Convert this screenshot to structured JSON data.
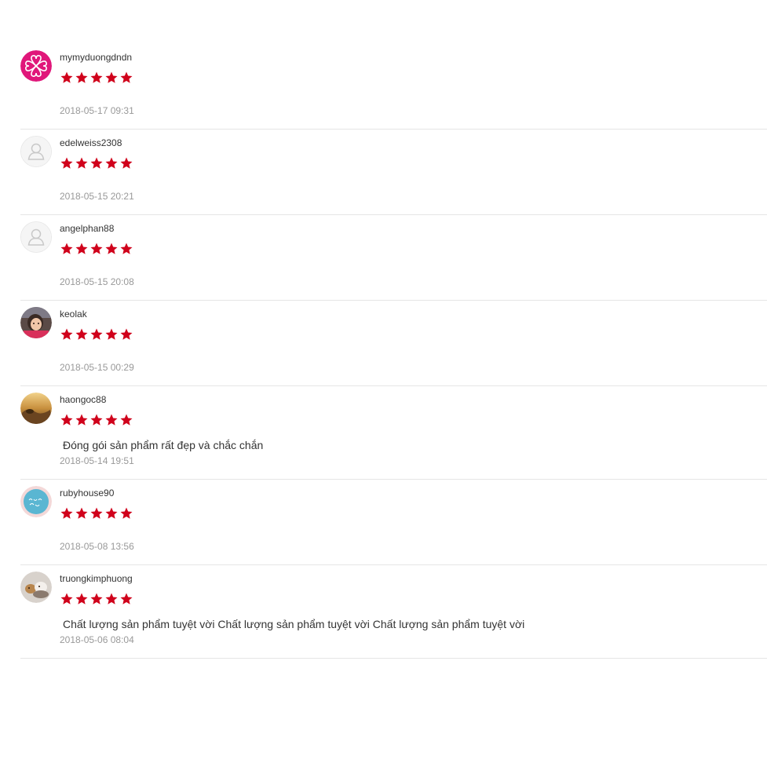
{
  "colors": {
    "star": "#d0011b",
    "divider": "#e5e5e5",
    "time": "#999999",
    "text": "#333333"
  },
  "reviews": [
    {
      "username": "mymyduongdndn",
      "rating": 5,
      "comment": "",
      "time": "2018-05-17 09:31",
      "avatar": "pink-clover-logo-avatar"
    },
    {
      "username": "edelweiss2308",
      "rating": 5,
      "comment": "",
      "time": "2018-05-15 20:21",
      "avatar": "default-user-avatar"
    },
    {
      "username": "angelphan88",
      "rating": 5,
      "comment": "",
      "time": "2018-05-15 20:08",
      "avatar": "default-user-avatar"
    },
    {
      "username": "keolak",
      "rating": 5,
      "comment": "",
      "time": "2018-05-15 00:29",
      "avatar": "child-photo-avatar"
    },
    {
      "username": "haongoc88",
      "rating": 5,
      "comment": "Đóng gói sản phẩm rất đẹp và chắc chắn",
      "time": "2018-05-14 19:51",
      "avatar": "sunset-field-photo-avatar"
    },
    {
      "username": "rubyhouse90",
      "rating": 5,
      "comment": "",
      "time": "2018-05-08 13:56",
      "avatar": "ruby-house-logo-avatar"
    },
    {
      "username": "truongkimphuong",
      "rating": 5,
      "comment": "Chất lượng sản phẩm tuyệt vời Chất lượng sản phẩm tuyệt vời Chất lượng sản phẩm tuyệt vời",
      "time": "2018-05-06 08:04",
      "avatar": "pets-photo-avatar"
    }
  ]
}
